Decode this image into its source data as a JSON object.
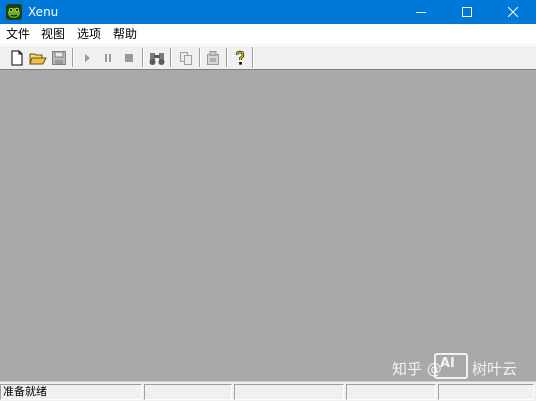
{
  "window": {
    "title": "Xenu",
    "controls": {
      "minimize": "minimize-icon",
      "maximize": "maximize-icon",
      "close": "close-icon"
    }
  },
  "menu": {
    "items": [
      {
        "label": "文件"
      },
      {
        "label": "视图"
      },
      {
        "label": "选项"
      },
      {
        "label": "帮助"
      }
    ]
  },
  "toolbar": {
    "tools": [
      {
        "icon": "new-file-icon",
        "enabled": true
      },
      {
        "icon": "open-folder-icon",
        "enabled": true
      },
      {
        "icon": "save-icon",
        "enabled": false
      },
      {
        "icon": "play-icon",
        "enabled": false
      },
      {
        "icon": "pause-icon",
        "enabled": false
      },
      {
        "icon": "stop-icon",
        "enabled": false
      },
      {
        "icon": "binoculars-icon",
        "enabled": false
      },
      {
        "icon": "copy-icon",
        "enabled": false
      },
      {
        "icon": "properties-icon",
        "enabled": false
      },
      {
        "icon": "help-icon",
        "enabled": true
      }
    ]
  },
  "statusbar": {
    "text": "准备就绪"
  },
  "watermark": {
    "prefix": "知乎 @",
    "logo": "AI",
    "suffix": "树叶云"
  },
  "colors": {
    "titlebar": "#0078d7",
    "client": "#a9a9a9",
    "chrome": "#f0f0f0"
  }
}
